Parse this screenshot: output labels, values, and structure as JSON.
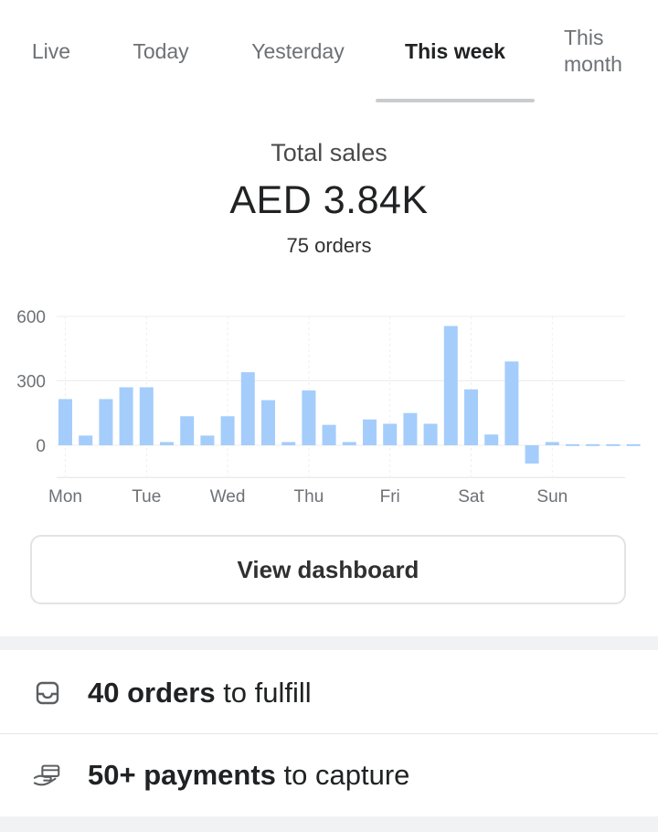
{
  "tabs": [
    {
      "label": "Live",
      "active": false
    },
    {
      "label": "Today",
      "active": false
    },
    {
      "label": "Yesterday",
      "active": false
    },
    {
      "label": "This week",
      "active": true
    },
    {
      "label_line1": "This",
      "label_line2": "month",
      "active": false
    }
  ],
  "summary": {
    "title": "Total sales",
    "amount": "AED 3.84K",
    "orders": "75 orders"
  },
  "chart_data": {
    "type": "bar",
    "color": "#a4cdfb",
    "y_ticks": [
      "600",
      "300",
      "0"
    ],
    "ylim": [
      -150,
      600
    ],
    "x_tick_labels": [
      "Mon",
      "Tue",
      "Wed",
      "Thu",
      "Fri",
      "Sat",
      "Sun"
    ],
    "values": [
      215,
      45,
      215,
      270,
      270,
      15,
      135,
      45,
      135,
      340,
      210,
      15,
      255,
      95,
      15,
      120,
      100,
      150,
      100,
      555,
      260,
      50,
      390,
      -85,
      15,
      5,
      5,
      5,
      5
    ]
  },
  "dashboard_button": {
    "label": "View dashboard"
  },
  "tasks": [
    {
      "icon": "inbox-icon",
      "bold": "40 orders",
      "rest": " to fulfill"
    },
    {
      "icon": "payment-hand-icon",
      "bold": "50+ payments",
      "rest": " to capture"
    }
  ]
}
